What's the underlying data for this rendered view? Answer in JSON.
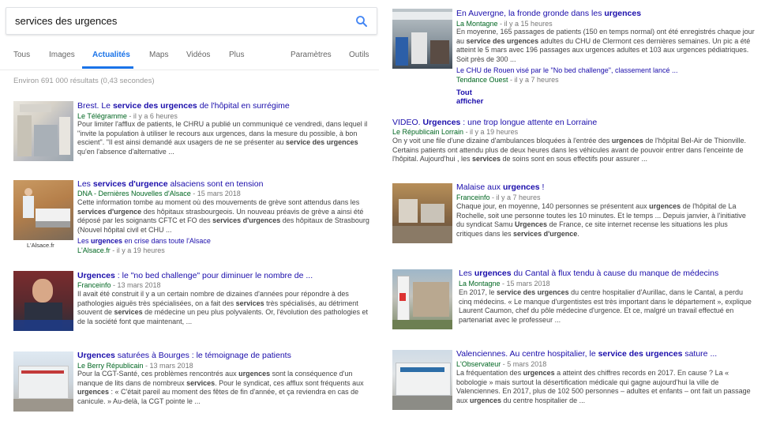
{
  "search": {
    "query": "services des urgences"
  },
  "tabs": [
    {
      "label": "Tous"
    },
    {
      "label": "Images"
    },
    {
      "label": "Actualités"
    },
    {
      "label": "Maps"
    },
    {
      "label": "Vidéos"
    },
    {
      "label": "Plus"
    }
  ],
  "tools": {
    "settings": "Paramètres",
    "tools": "Outils"
  },
  "stats": "Environ 691 000 résultats (0,43 secondes)",
  "left": [
    {
      "title": "Brest. Le service des urgences de l'hôpital en surrégime",
      "source": "Le Télégramme",
      "time": " - il y a 6 heures",
      "snippet": "Pour limiter l'afflux de patients, le CHRU a publié un communiqué ce vendredi, dans lequel il \"invite la population à utiliser le recours aux urgences, dans la mesure du possible, à bon escient\". \"Il est ainsi demandé aux usagers de ne se présenter au service des urgences qu'en l'absence d'alternative ..."
    },
    {
      "title": "Les services d'urgence alsaciens sont en tension",
      "source": "DNA - Dernières Nouvelles d'Alsace",
      "time": " - 15 mars 2018",
      "snippet": "Cette information tombe au moment où des mouvements de grève sont attendus dans les services d'urgence des hôpitaux strasbourgeois. Un nouveau préavis de grève a ainsi été déposé par les soignants CFTC et FO des services d'urgences des hôpitaux de Strasbourg (Nouvel hôpital civil et CHU ...",
      "sublink": "Les urgences en crise dans toute l'Alsace",
      "sub_source": "L'Alsace.fr",
      "sub_time": " - il y a 19 heures",
      "caption": "L'Alsace.fr"
    },
    {
      "title": "Urgences : le \"no bed challenge\" pour diminuer le nombre de ...",
      "source": "Franceinfo",
      "time": " - 13 mars 2018",
      "snippet": "Il avait été construit il y a un certain nombre de dizaines d'années pour répondre à des pathologies aiguës très spécialisées, on a fait des services très spécialisés, au détriment souvent de services de médecine un peu plus polyvalents. Or, l'évolution des pathologies et de la société font que maintenant, ..."
    },
    {
      "title": "Urgences saturées à Bourges : le témoignage de patients",
      "source": "Le Berry Républicain",
      "time": " - 13 mars 2018",
      "snippet": "Pour la CGT-Santé, ces problèmes rencontrés aux urgences sont la conséquence d'un manque de lits dans de nombreux services. Pour le syndicat, ces afflux sont fréquents aux urgences : « C'était pareil au moment des fêtes de fin d'année, et ça reviendra en cas de canicule. » Au-delà, la CGT pointe le ..."
    }
  ],
  "right": [
    {
      "title": "En Auvergne, la fronde gronde dans les urgences",
      "source": "La Montagne",
      "time": " - il y a 15 heures",
      "snippet": "En moyenne, 165 passages de patients (150 en temps normal) ont été enregistrés chaque jour au service des urgences adultes du CHU de Clermont ces dernières semaines. Un pic a été atteint le 5 mars avec 196 passages aux urgences adultes et 103 aux urgences pédiatriques. Soit près de 300 ...",
      "sublink": "Le CHU de Rouen visé par le \"No bed challenge\", classement lancé ...",
      "sub_source": "Tendance Ouest",
      "sub_time": " - il y a 7 heures",
      "see_all": "Tout afficher"
    },
    {
      "title": "VIDEO. Urgences : une trop longue attente en Lorraine",
      "source": "Le Républicain Lorrain",
      "time": " - il y a 19 heures",
      "snippet": "On y voit une file d'une dizaine d'ambulances bloquées à l'entrée des urgences de l'hôpital Bel-Air de Thionville. Certains patients ont attendu plus de deux heures dans les véhicules avant de pouvoir entrer dans l'enceinte de l'hôpital. Aujourd'hui , les services de soins sont en sous effectifs pour assurer ..."
    },
    {
      "title": "Malaise aux urgences !",
      "source": "Franceinfo",
      "time": " - il y a 7 heures",
      "snippet": "Chaque jour, en moyenne, 140 personnes se présentent aux urgences de l'hôpital de La Rochelle, soit une personne toutes les 10 minutes. Et le temps ... Depuis janvier, à l'initiative du syndicat Samu Urgences de France, ce site internet recense les situations les plus critiques dans les services d'urgence."
    },
    {
      "title": "Les urgences du Cantal à flux tendu à cause du manque de médecins",
      "source": "La Montagne",
      "time": " - 15 mars 2018",
      "snippet": "En 2017, le service des urgences du centre hospitalier d'Aurillac, dans le Cantal, a perdu cinq médecins. « Le manque d'urgentistes est très important dans le département », explique Laurent Caumon, chef du pôle médecine d'urgence. Et ce, malgré un travail effectué en partenariat avec le professeur ..."
    },
    {
      "title": "Valenciennes. Au centre hospitalier, le service des urgences sature ...",
      "source": "L'Observateur",
      "time": " - 5 mars 2018",
      "snippet": "La fréquentation des urgences a atteint des chiffres records en 2017. En cause ? La « bobologie » mais surtout la désertification médicale qui gagne aujourd'hui la ville de Valenciennes. En 2017, plus de 102 500 personnes – adultes et enfants – ont fait un passage aux urgences du centre hospitalier de ..."
    }
  ],
  "colors": {
    "link": "#1a0dab",
    "source": "#006621",
    "accent": "#1a73e8"
  }
}
